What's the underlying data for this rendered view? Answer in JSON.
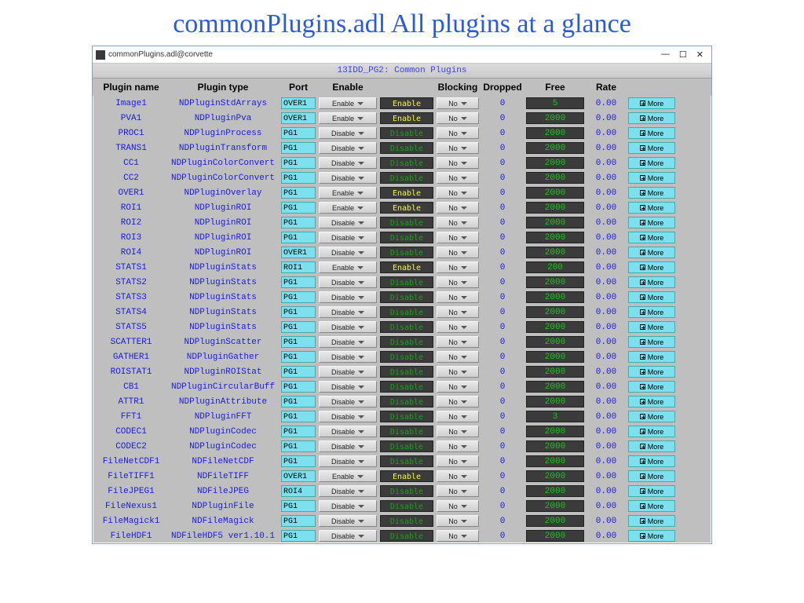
{
  "slide_title": "commonPlugins.adl All plugins at a glance",
  "window": {
    "icon": "app-icon",
    "title": "commonPlugins.adl@corvette",
    "controls": {
      "min": "—",
      "max": "☐",
      "close": "✕"
    },
    "banner": "13IDD_PG2: Common Plugins"
  },
  "headers": {
    "name": "Plugin name",
    "type": "Plugin type",
    "port": "Port",
    "enable": "Enable",
    "blocking": "Blocking",
    "dropped": "Dropped",
    "free": "Free",
    "rate": "Rate"
  },
  "labels": {
    "enable_btn": "Enable",
    "disable_btn": "Disable",
    "no_btn": "No",
    "more_btn": "More"
  },
  "rows": [
    {
      "name": "Image1",
      "type": "NDPluginStdArrays",
      "port": "OVER1",
      "btn": "Enable",
      "status": "Enable",
      "dropped": "0",
      "free": "5",
      "rate": "0.00"
    },
    {
      "name": "PVA1",
      "type": "NDPluginPva",
      "port": "OVER1",
      "btn": "Enable",
      "status": "Enable",
      "dropped": "0",
      "free": "2000",
      "rate": "0.00"
    },
    {
      "name": "PROC1",
      "type": "NDPluginProcess",
      "port": "PG1",
      "btn": "Disable",
      "status": "Disable",
      "dropped": "0",
      "free": "2000",
      "rate": "0.00"
    },
    {
      "name": "TRANS1",
      "type": "NDPluginTransform",
      "port": "PG1",
      "btn": "Disable",
      "status": "Disable",
      "dropped": "0",
      "free": "2000",
      "rate": "0.00"
    },
    {
      "name": "CC1",
      "type": "NDPluginColorConvert",
      "port": "PG1",
      "btn": "Disable",
      "status": "Disable",
      "dropped": "0",
      "free": "2000",
      "rate": "0.00"
    },
    {
      "name": "CC2",
      "type": "NDPluginColorConvert",
      "port": "PG1",
      "btn": "Disable",
      "status": "Disable",
      "dropped": "0",
      "free": "2000",
      "rate": "0.00"
    },
    {
      "name": "OVER1",
      "type": "NDPluginOverlay",
      "port": "PG1",
      "btn": "Enable",
      "status": "Enable",
      "dropped": "0",
      "free": "2000",
      "rate": "0.00"
    },
    {
      "name": "ROI1",
      "type": "NDPluginROI",
      "port": "PG1",
      "btn": "Enable",
      "status": "Enable",
      "dropped": "0",
      "free": "2000",
      "rate": "0.00"
    },
    {
      "name": "ROI2",
      "type": "NDPluginROI",
      "port": "PG1",
      "btn": "Disable",
      "status": "Disable",
      "dropped": "0",
      "free": "2000",
      "rate": "0.00"
    },
    {
      "name": "ROI3",
      "type": "NDPluginROI",
      "port": "PG1",
      "btn": "Disable",
      "status": "Disable",
      "dropped": "0",
      "free": "2000",
      "rate": "0.00"
    },
    {
      "name": "ROI4",
      "type": "NDPluginROI",
      "port": "OVER1",
      "btn": "Disable",
      "status": "Disable",
      "dropped": "0",
      "free": "2000",
      "rate": "0.00"
    },
    {
      "name": "STATS1",
      "type": "NDPluginStats",
      "port": "ROI1",
      "btn": "Enable",
      "status": "Enable",
      "dropped": "0",
      "free": "200",
      "rate": "0.00"
    },
    {
      "name": "STATS2",
      "type": "NDPluginStats",
      "port": "PG1",
      "btn": "Disable",
      "status": "Disable",
      "dropped": "0",
      "free": "2000",
      "rate": "0.00"
    },
    {
      "name": "STATS3",
      "type": "NDPluginStats",
      "port": "PG1",
      "btn": "Disable",
      "status": "Disable",
      "dropped": "0",
      "free": "2000",
      "rate": "0.00"
    },
    {
      "name": "STATS4",
      "type": "NDPluginStats",
      "port": "PG1",
      "btn": "Disable",
      "status": "Disable",
      "dropped": "0",
      "free": "2000",
      "rate": "0.00"
    },
    {
      "name": "STATS5",
      "type": "NDPluginStats",
      "port": "PG1",
      "btn": "Disable",
      "status": "Disable",
      "dropped": "0",
      "free": "2000",
      "rate": "0.00"
    },
    {
      "name": "SCATTER1",
      "type": "NDPluginScatter",
      "port": "PG1",
      "btn": "Disable",
      "status": "Disable",
      "dropped": "0",
      "free": "2000",
      "rate": "0.00"
    },
    {
      "name": "GATHER1",
      "type": "NDPluginGather",
      "port": "PG1",
      "btn": "Disable",
      "status": "Disable",
      "dropped": "0",
      "free": "2000",
      "rate": "0.00"
    },
    {
      "name": "ROISTAT1",
      "type": "NDPluginROIStat",
      "port": "PG1",
      "btn": "Disable",
      "status": "Disable",
      "dropped": "0",
      "free": "2000",
      "rate": "0.00"
    },
    {
      "name": "CB1",
      "type": "NDPluginCircularBuff",
      "port": "PG1",
      "btn": "Disable",
      "status": "Disable",
      "dropped": "0",
      "free": "2000",
      "rate": "0.00"
    },
    {
      "name": "ATTR1",
      "type": "NDPluginAttribute",
      "port": "PG1",
      "btn": "Disable",
      "status": "Disable",
      "dropped": "0",
      "free": "2000",
      "rate": "0.00"
    },
    {
      "name": "FFT1",
      "type": "NDPluginFFT",
      "port": "PG1",
      "btn": "Disable",
      "status": "Disable",
      "dropped": "0",
      "free": "3",
      "rate": "0.00"
    },
    {
      "name": "CODEC1",
      "type": "NDPluginCodec",
      "port": "PG1",
      "btn": "Disable",
      "status": "Disable",
      "dropped": "0",
      "free": "2000",
      "rate": "0.00"
    },
    {
      "name": "CODEC2",
      "type": "NDPluginCodec",
      "port": "PG1",
      "btn": "Disable",
      "status": "Disable",
      "dropped": "0",
      "free": "2000",
      "rate": "0.00"
    },
    {
      "name": "FileNetCDF1",
      "type": "NDFileNetCDF",
      "port": "PG1",
      "btn": "Disable",
      "status": "Disable",
      "dropped": "0",
      "free": "2000",
      "rate": "0.00"
    },
    {
      "name": "FileTIFF1",
      "type": "NDFileTIFF",
      "port": "OVER1",
      "btn": "Enable",
      "status": "Enable",
      "dropped": "0",
      "free": "2000",
      "rate": "0.00"
    },
    {
      "name": "FileJPEG1",
      "type": "NDFileJPEG",
      "port": "ROI4",
      "btn": "Disable",
      "status": "Disable",
      "dropped": "0",
      "free": "2000",
      "rate": "0.00"
    },
    {
      "name": "FileNexus1",
      "type": "NDPluginFile",
      "port": "PG1",
      "btn": "Disable",
      "status": "Disable",
      "dropped": "0",
      "free": "2000",
      "rate": "0.00"
    },
    {
      "name": "FileMagick1",
      "type": "NDFileMagick",
      "port": "PG1",
      "btn": "Disable",
      "status": "Disable",
      "dropped": "0",
      "free": "2000",
      "rate": "0.00"
    },
    {
      "name": "FileHDF1",
      "type": "NDFileHDF5 ver1.10.1",
      "port": "PG1",
      "btn": "Disable",
      "status": "Disable",
      "dropped": "0",
      "free": "2000",
      "rate": "0.00"
    }
  ]
}
